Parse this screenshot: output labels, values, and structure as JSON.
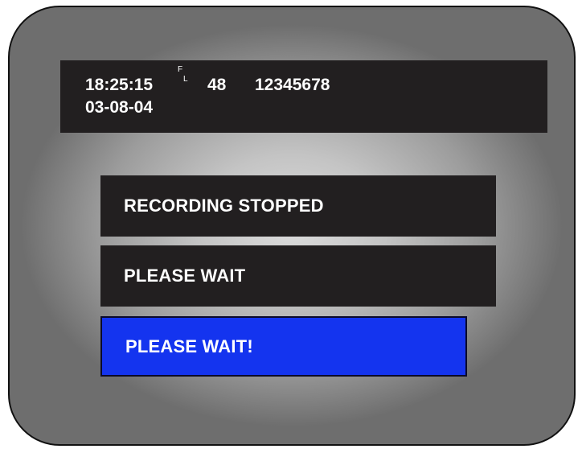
{
  "osd": {
    "time": "18:25:15",
    "field_f": "F",
    "field_l": "L",
    "frame": "48",
    "counter": "12345678",
    "date": "03-08-04"
  },
  "messages": {
    "status": "RECORDING STOPPED",
    "wait": "PLEASE WAIT",
    "wait_highlight": "PLEASE WAIT!"
  },
  "colors": {
    "osd_background": "#221f20",
    "highlight": "#1434ef",
    "text": "#ffffff"
  }
}
